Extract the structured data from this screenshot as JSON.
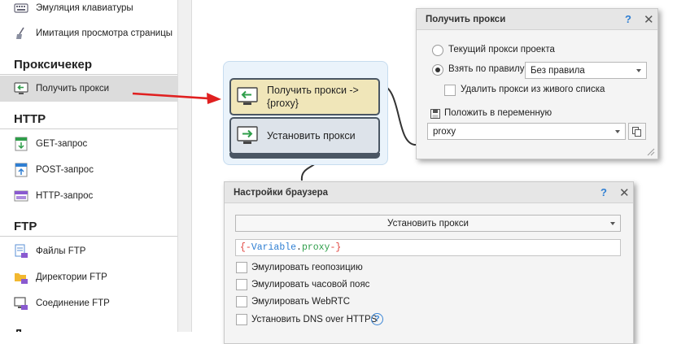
{
  "sidebar": {
    "items_top": [
      {
        "label": "Эмуляция клавиатуры",
        "icon": "keyboard-icon"
      },
      {
        "label": "Имитация просмотра страницы",
        "icon": "broom-icon"
      }
    ],
    "headings": {
      "proxy": "Проксичекер",
      "http": "HTTP",
      "ftp": "FTP"
    },
    "proxy_items": [
      {
        "label": "Получить прокси",
        "icon": "get-proxy-icon",
        "active": true
      }
    ],
    "http_items": [
      {
        "label": "GET-запрос",
        "icon": "get-request-icon"
      },
      {
        "label": "POST-запрос",
        "icon": "post-request-icon"
      },
      {
        "label": "HTTP-запрос",
        "icon": "http-request-icon"
      }
    ],
    "ftp_items": [
      {
        "label": "Файлы FTP",
        "icon": "ftp-files-icon"
      },
      {
        "label": "Директории FTP",
        "icon": "ftp-folder-icon"
      },
      {
        "label": "Соединение FTP",
        "icon": "ftp-connection-icon"
      }
    ]
  },
  "canvas": {
    "node_get": {
      "label": "Получить прокси ->\n{proxy}"
    },
    "node_set": {
      "label": "Установить прокси"
    }
  },
  "proxy_dialog": {
    "title": "Получить прокси",
    "help": "?",
    "close": "✕",
    "radio_current": "Текущий прокси проекта",
    "radio_rule": "Взять по правилу:",
    "rule_value": "Без правила",
    "delete_from_list": "Удалить прокси из живого списка",
    "save_to_var": "Положить в переменную",
    "var_value": "proxy"
  },
  "browser_dialog": {
    "title": "Настройки браузера",
    "help": "?",
    "close": "✕",
    "action_value": "Установить прокси",
    "expr": {
      "open": "{-",
      "var_kw": "Variable",
      "dot": ".",
      "name": "proxy",
      "close": "-}"
    },
    "opt_geo": "Эмулировать геопозицию",
    "opt_tz": "Эмулировать часовой пояс",
    "opt_webrtc": "Эмулировать WebRTC",
    "opt_dns": "Установить DNS over HTTPS"
  },
  "colors": {
    "accent_blue": "#2f7fd3",
    "arrow_red": "#e02020",
    "node_get_bg": "#f0e6b9",
    "node_set_bg": "#dde3ea",
    "icon_green": "#2e9e4a"
  }
}
